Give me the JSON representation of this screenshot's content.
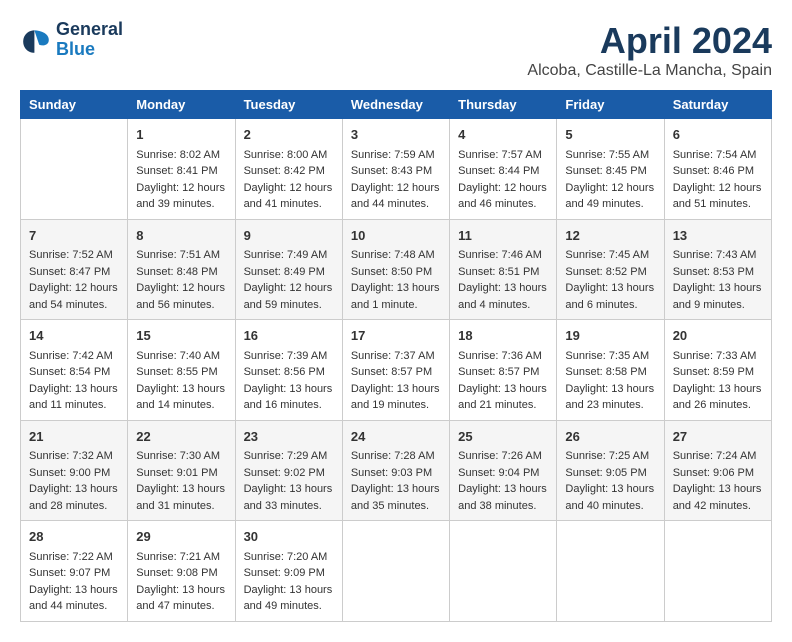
{
  "logo": {
    "line1": "General",
    "line2": "Blue"
  },
  "title": "April 2024",
  "location": "Alcoba, Castille-La Mancha, Spain",
  "days_of_week": [
    "Sunday",
    "Monday",
    "Tuesday",
    "Wednesday",
    "Thursday",
    "Friday",
    "Saturday"
  ],
  "weeks": [
    [
      {
        "day": "",
        "content": ""
      },
      {
        "day": "1",
        "content": "Sunrise: 8:02 AM\nSunset: 8:41 PM\nDaylight: 12 hours\nand 39 minutes."
      },
      {
        "day": "2",
        "content": "Sunrise: 8:00 AM\nSunset: 8:42 PM\nDaylight: 12 hours\nand 41 minutes."
      },
      {
        "day": "3",
        "content": "Sunrise: 7:59 AM\nSunset: 8:43 PM\nDaylight: 12 hours\nand 44 minutes."
      },
      {
        "day": "4",
        "content": "Sunrise: 7:57 AM\nSunset: 8:44 PM\nDaylight: 12 hours\nand 46 minutes."
      },
      {
        "day": "5",
        "content": "Sunrise: 7:55 AM\nSunset: 8:45 PM\nDaylight: 12 hours\nand 49 minutes."
      },
      {
        "day": "6",
        "content": "Sunrise: 7:54 AM\nSunset: 8:46 PM\nDaylight: 12 hours\nand 51 minutes."
      }
    ],
    [
      {
        "day": "7",
        "content": "Sunrise: 7:52 AM\nSunset: 8:47 PM\nDaylight: 12 hours\nand 54 minutes."
      },
      {
        "day": "8",
        "content": "Sunrise: 7:51 AM\nSunset: 8:48 PM\nDaylight: 12 hours\nand 56 minutes."
      },
      {
        "day": "9",
        "content": "Sunrise: 7:49 AM\nSunset: 8:49 PM\nDaylight: 12 hours\nand 59 minutes."
      },
      {
        "day": "10",
        "content": "Sunrise: 7:48 AM\nSunset: 8:50 PM\nDaylight: 13 hours\nand 1 minute."
      },
      {
        "day": "11",
        "content": "Sunrise: 7:46 AM\nSunset: 8:51 PM\nDaylight: 13 hours\nand 4 minutes."
      },
      {
        "day": "12",
        "content": "Sunrise: 7:45 AM\nSunset: 8:52 PM\nDaylight: 13 hours\nand 6 minutes."
      },
      {
        "day": "13",
        "content": "Sunrise: 7:43 AM\nSunset: 8:53 PM\nDaylight: 13 hours\nand 9 minutes."
      }
    ],
    [
      {
        "day": "14",
        "content": "Sunrise: 7:42 AM\nSunset: 8:54 PM\nDaylight: 13 hours\nand 11 minutes."
      },
      {
        "day": "15",
        "content": "Sunrise: 7:40 AM\nSunset: 8:55 PM\nDaylight: 13 hours\nand 14 minutes."
      },
      {
        "day": "16",
        "content": "Sunrise: 7:39 AM\nSunset: 8:56 PM\nDaylight: 13 hours\nand 16 minutes."
      },
      {
        "day": "17",
        "content": "Sunrise: 7:37 AM\nSunset: 8:57 PM\nDaylight: 13 hours\nand 19 minutes."
      },
      {
        "day": "18",
        "content": "Sunrise: 7:36 AM\nSunset: 8:57 PM\nDaylight: 13 hours\nand 21 minutes."
      },
      {
        "day": "19",
        "content": "Sunrise: 7:35 AM\nSunset: 8:58 PM\nDaylight: 13 hours\nand 23 minutes."
      },
      {
        "day": "20",
        "content": "Sunrise: 7:33 AM\nSunset: 8:59 PM\nDaylight: 13 hours\nand 26 minutes."
      }
    ],
    [
      {
        "day": "21",
        "content": "Sunrise: 7:32 AM\nSunset: 9:00 PM\nDaylight: 13 hours\nand 28 minutes."
      },
      {
        "day": "22",
        "content": "Sunrise: 7:30 AM\nSunset: 9:01 PM\nDaylight: 13 hours\nand 31 minutes."
      },
      {
        "day": "23",
        "content": "Sunrise: 7:29 AM\nSunset: 9:02 PM\nDaylight: 13 hours\nand 33 minutes."
      },
      {
        "day": "24",
        "content": "Sunrise: 7:28 AM\nSunset: 9:03 PM\nDaylight: 13 hours\nand 35 minutes."
      },
      {
        "day": "25",
        "content": "Sunrise: 7:26 AM\nSunset: 9:04 PM\nDaylight: 13 hours\nand 38 minutes."
      },
      {
        "day": "26",
        "content": "Sunrise: 7:25 AM\nSunset: 9:05 PM\nDaylight: 13 hours\nand 40 minutes."
      },
      {
        "day": "27",
        "content": "Sunrise: 7:24 AM\nSunset: 9:06 PM\nDaylight: 13 hours\nand 42 minutes."
      }
    ],
    [
      {
        "day": "28",
        "content": "Sunrise: 7:22 AM\nSunset: 9:07 PM\nDaylight: 13 hours\nand 44 minutes."
      },
      {
        "day": "29",
        "content": "Sunrise: 7:21 AM\nSunset: 9:08 PM\nDaylight: 13 hours\nand 47 minutes."
      },
      {
        "day": "30",
        "content": "Sunrise: 7:20 AM\nSunset: 9:09 PM\nDaylight: 13 hours\nand 49 minutes."
      },
      {
        "day": "",
        "content": ""
      },
      {
        "day": "",
        "content": ""
      },
      {
        "day": "",
        "content": ""
      },
      {
        "day": "",
        "content": ""
      }
    ]
  ]
}
